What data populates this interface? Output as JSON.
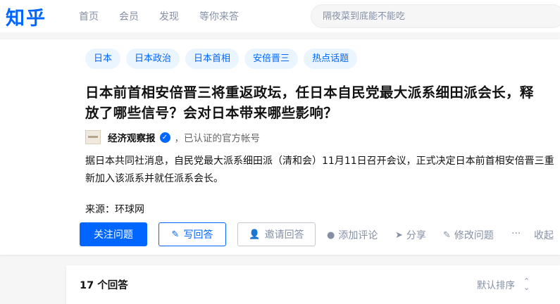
{
  "logo": "知乎",
  "nav": [
    {
      "label": "首页"
    },
    {
      "label": "会员"
    },
    {
      "label": "发现"
    },
    {
      "label": "等你来答"
    }
  ],
  "search": {
    "placeholder": "隔夜菜到底能不能吃"
  },
  "question": {
    "tags": [
      "日本",
      "日本政治",
      "日本首相",
      "安倍晋三",
      "热点话题"
    ],
    "title": "日本前首相安倍晋三将重返政坛，任日本自民党最大派系细田派会长，释放了哪些信号？会对日本带来哪些影响？",
    "author": {
      "name": "经济观察报",
      "desc": "，已认证的官方帐号",
      "verified_icon": "verified-check-icon"
    },
    "content": "据日本共同社消息，自民党最大派系细田派（清和会）11月11日召开会议，正式决定日本前首相安倍晋三重新加入该派系并就任派系会长。",
    "source": "来源：环球网"
  },
  "actions": {
    "follow": "关注问题",
    "write": "写回答",
    "invite": "邀请回答",
    "comment": "添加评论",
    "share": "分享",
    "edit": "修改问题",
    "more": "···",
    "collapse": "收起"
  },
  "answers": {
    "count": "17 个回答",
    "sort_label": "默认排序"
  },
  "colors": {
    "brand": "#0066ff",
    "tag_bg": "#ebf5ff",
    "muted": "#8590a6"
  }
}
